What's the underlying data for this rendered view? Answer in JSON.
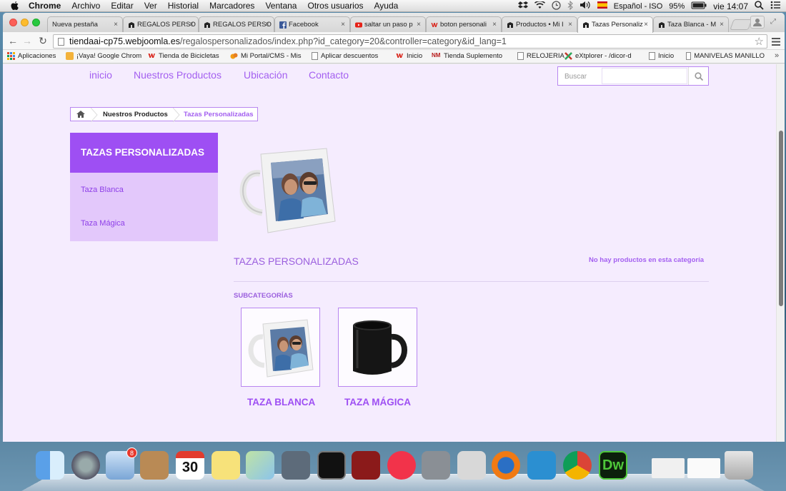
{
  "menubar": {
    "app": "Chrome",
    "items": [
      "Archivo",
      "Editar",
      "Ver",
      "Historial",
      "Marcadores",
      "Ventana",
      "Otros usuarios",
      "Ayuda"
    ],
    "input_source": "Español - ISO",
    "battery": "95%",
    "clock": "vie 14:07"
  },
  "tabs": [
    {
      "title": "Nueva pestaña",
      "icon": "blank-icon"
    },
    {
      "title": "REGALOS PERSO",
      "icon": "joomla-icon"
    },
    {
      "title": "REGALOS PERSO",
      "icon": "joomla-icon"
    },
    {
      "title": "Facebook",
      "icon": "facebook-icon"
    },
    {
      "title": "saltar un paso p",
      "icon": "youtube-icon"
    },
    {
      "title": "boton personali",
      "icon": "webnode-icon"
    },
    {
      "title": "Productos • Mi I",
      "icon": "joomla-icon"
    },
    {
      "title": "Tazas Personaliz",
      "icon": "joomla-icon",
      "active": true
    },
    {
      "title": "Taza Blanca - M",
      "icon": "joomla-icon"
    }
  ],
  "address": {
    "host": "tiendaai-cp75.webjoomla.es",
    "path": "/regalospersonalizados/index.php?id_category=20&controller=category&id_lang=1"
  },
  "bookmarks": [
    {
      "label": "Aplicaciones",
      "icon": "apps-icon"
    },
    {
      "label": "¡Vaya! Google Chrom",
      "icon": "folder-icon"
    },
    {
      "label": "Tienda de Bicicletas",
      "icon": "webnode-icon"
    },
    {
      "label": "Mi Portal/CMS - Mis",
      "icon": "cms-icon"
    },
    {
      "label": "Aplicar descuentos",
      "icon": "page-icon"
    },
    {
      "label": "Inicio",
      "icon": "webnode-icon"
    },
    {
      "label": "Tienda Suplemento",
      "icon": "nm-icon"
    },
    {
      "label": "RELOJERIA",
      "icon": "page-icon"
    },
    {
      "label": "eXtplorer - /dicor-d",
      "icon": "extplorer-icon"
    },
    {
      "label": "Inicio",
      "icon": "page-icon"
    },
    {
      "label": "MANIVELAS MANILLO",
      "icon": "page-icon"
    }
  ],
  "site": {
    "nav": [
      "inicio",
      "Nuestros Productos",
      "Ubicación",
      "Contacto"
    ],
    "search_label": "Buscar",
    "breadcrumb": [
      "Nuestros Productos",
      "Tazas Personalizadas"
    ],
    "sidebar": {
      "title": "TAZAS PERSONALIZADAS",
      "items": [
        "Taza Blanca",
        "Taza Mágica"
      ]
    },
    "category_title": "TAZAS PERSONALIZADAS",
    "no_products": "No hay productos en esta categoría",
    "subcategories_heading": "SUBCATEGORÍAS",
    "subcategories": [
      "TAZA BLANCA",
      "TAZA MÁGICA"
    ]
  },
  "dock": {
    "mail_badge": "8",
    "calendar_day": "30",
    "apps": [
      "finder-icon",
      "launchpad-icon",
      "mail-icon",
      "contacts-icon",
      "calendar-icon",
      "notes-icon",
      "maps-icon",
      "facetime-icon",
      "activity-monitor-icon",
      "photobooth-icon",
      "itunes-icon",
      "system-preferences-icon",
      "grab-icon",
      "firefox-icon",
      "filezilla-icon",
      "chrome-icon",
      "dreamweaver-icon",
      "minimized-window-icon",
      "minimized-window-icon",
      "trash-icon"
    ],
    "dreamweaver_label": "Dw"
  },
  "colors": {
    "accent": "#9e4ff3",
    "link": "#a35ff0",
    "page_bg": "#f5ecfe",
    "sidebar_bg": "#e3c8fb"
  }
}
